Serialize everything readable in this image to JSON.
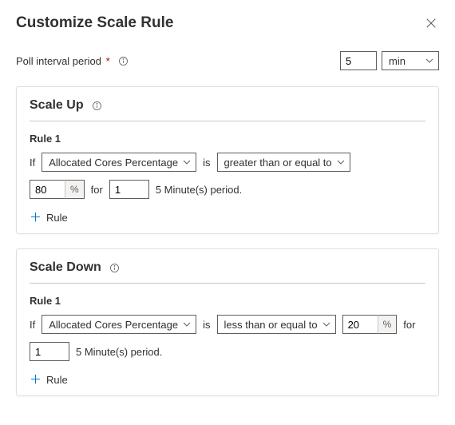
{
  "header": {
    "title": "Customize Scale Rule"
  },
  "poll": {
    "label": "Poll interval period",
    "value": "5",
    "unit_selected": "min"
  },
  "scale_up": {
    "title": "Scale Up",
    "rule_label": "Rule 1",
    "if_label": "If",
    "metric": "Allocated Cores Percentage",
    "is_label": "is",
    "operator": "greater than or equal to",
    "threshold": "80",
    "threshold_unit": "%",
    "for_label": "for",
    "period_count": "1",
    "period_text": "5 Minute(s) period.",
    "add_rule_label": "Rule"
  },
  "scale_down": {
    "title": "Scale Down",
    "rule_label": "Rule 1",
    "if_label": "If",
    "metric": "Allocated Cores Percentage",
    "is_label": "is",
    "operator": "less than or equal to",
    "threshold": "20",
    "threshold_unit": "%",
    "for_label": "for",
    "period_count": "1",
    "period_text": "5 Minute(s) period.",
    "add_rule_label": "Rule"
  }
}
